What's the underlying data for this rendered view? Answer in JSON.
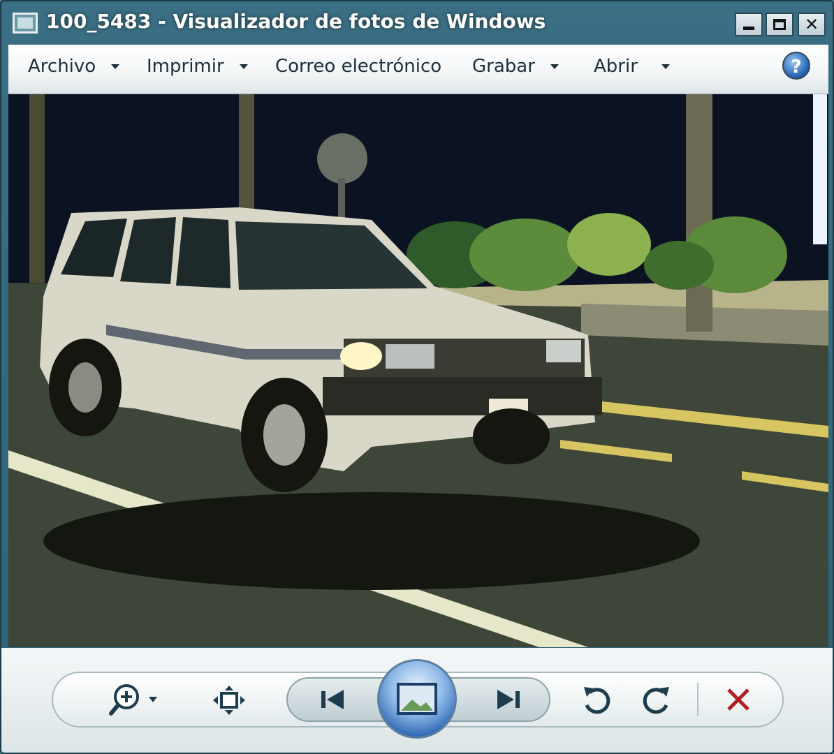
{
  "window": {
    "title": "100_5483 - Visualizador de fotos de Windows"
  },
  "menu": {
    "file": "Archivo",
    "print": "Imprimir",
    "email": "Correo electrónico",
    "burn": "Grabar",
    "open": "Abrir"
  },
  "icons": {
    "help": "help-icon",
    "zoom": "magnifier-plus-icon",
    "fit": "fit-to-window-icon",
    "previous": "skip-previous-icon",
    "slideshow": "slideshow-icon",
    "next": "skip-next-icon",
    "rotate_left": "rotate-counterclockwise-icon",
    "rotate_right": "rotate-clockwise-icon",
    "delete": "delete-x-icon"
  },
  "colors": {
    "accent": "#2d66b2",
    "delete": "#b02020"
  }
}
